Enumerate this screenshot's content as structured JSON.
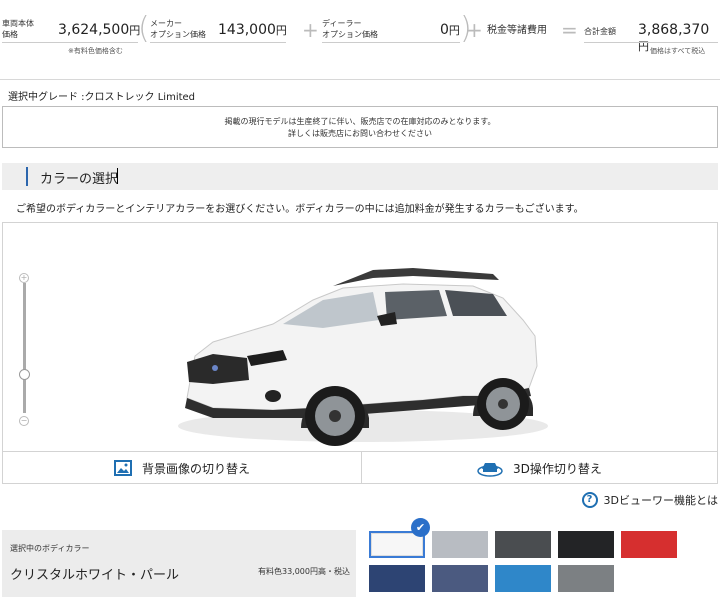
{
  "price": {
    "vehicle_label_1": "車両本体",
    "vehicle_label_2": "価格",
    "vehicle_value": "3,624,500",
    "yen": "円",
    "vehicle_note": "※有料色価格含む",
    "maker_label_1": "メーカー",
    "maker_label_2": "オプション価格",
    "maker_value": "143,000",
    "dealer_label_1": "ディーラー",
    "dealer_label_2": "オプション価格",
    "dealer_value": "0",
    "tax_label": "税金等諸費用",
    "total_label": "合計金額",
    "total_value": "3,868,370",
    "total_note": "価格はすべて税込",
    "plus": "+",
    "equals": "="
  },
  "grade": {
    "label": "選択中グレード :クロストレック Limited"
  },
  "notice": {
    "line1": "掲載の現行モデルは生産終了に伴い、販売店での在庫対応のみとなります。",
    "line2": "詳しくは販売店にお問い合わせください"
  },
  "section": {
    "title": "カラーの選択"
  },
  "description": "ご希望のボディカラーとインテリアカラーをお選びください。ボディカラーの中には追加料金が発生するカラーもございます。",
  "viewer": {
    "zoom_in": "+",
    "zoom_out": "−",
    "bg_button": "背景画像の切り替え",
    "op_button": "3D操作切り替え"
  },
  "help": {
    "icon": "?",
    "label": "3Dビューワー機能とは"
  },
  "body_color": {
    "label": "選択中のボディカラー",
    "name": "クリスタルホワイト・パール",
    "price": "有料色33,000円高・税込"
  },
  "swatches": [
    {
      "color": "#f7f7f7",
      "selected": true
    },
    {
      "color": "#b8bcc2",
      "selected": false
    },
    {
      "color": "#4a4d50",
      "selected": false
    },
    {
      "color": "#232426",
      "selected": false
    },
    {
      "color": "#d62f2f",
      "selected": false
    },
    {
      "color": "#2d4473",
      "selected": false
    },
    {
      "color": "#4b5a80",
      "selected": false
    },
    {
      "color": "#2f87c9",
      "selected": false
    },
    {
      "color": "#7c8083",
      "selected": false
    }
  ],
  "check_mark": "✔"
}
